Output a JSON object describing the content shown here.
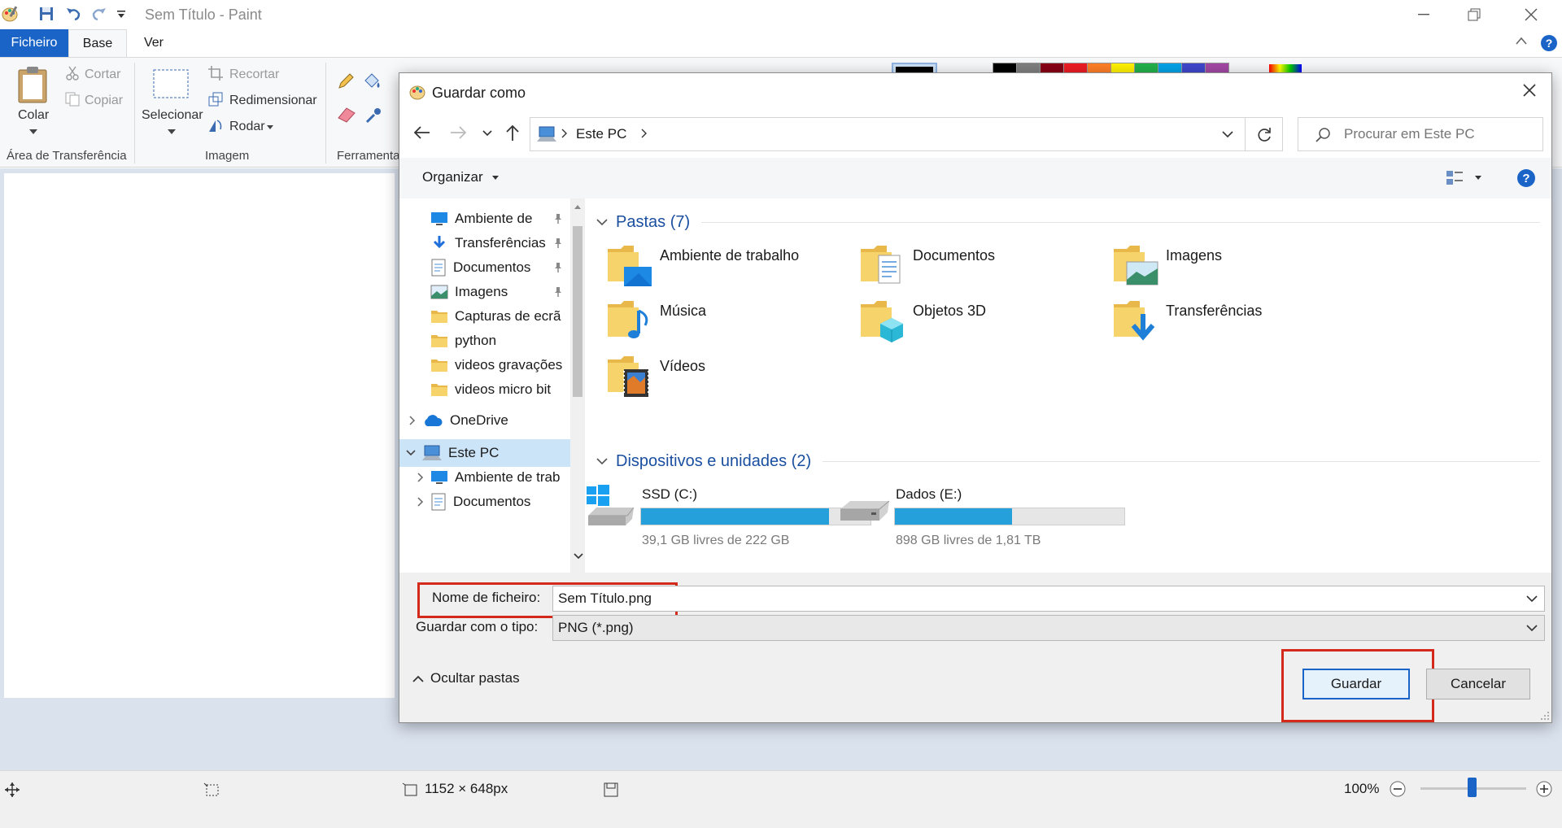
{
  "paint": {
    "window_title": "Sem Título - Paint",
    "tabs": {
      "file": "Ficheiro",
      "home": "Base",
      "view": "Ver"
    },
    "clipboard": {
      "paste": "Colar",
      "cut": "Cortar",
      "copy": "Copiar",
      "group": "Área de Transferência"
    },
    "image": {
      "select": "Selecionar",
      "crop": "Recortar",
      "resize": "Redimensionar",
      "rotate": "Rodar",
      "group": "Imagem"
    },
    "tools": {
      "group": "Ferramenta"
    },
    "colors": [
      "#000000",
      "#7f7f7f",
      "#880015",
      "#ed1c24",
      "#ff7f27",
      "#fff200",
      "#22b14c",
      "#00a2e8",
      "#3f48cc",
      "#a349a4"
    ],
    "status": {
      "dimensions": "1152 × 648px",
      "zoom": "100%"
    }
  },
  "dialog": {
    "title": "Guardar como",
    "address": {
      "location": "Este PC"
    },
    "search_placeholder": "Procurar em Este PC",
    "toolbar": {
      "organize": "Organizar"
    },
    "nav": [
      {
        "label": "Ambiente de",
        "icon": "desktop-icon",
        "pinned": true
      },
      {
        "label": "Transferências",
        "icon": "download-icon",
        "pinned": true
      },
      {
        "label": "Documentos",
        "icon": "documents-icon",
        "pinned": true
      },
      {
        "label": "Imagens",
        "icon": "pictures-icon",
        "pinned": true
      },
      {
        "label": "Capturas de ecrã",
        "icon": "folder-icon"
      },
      {
        "label": "python",
        "icon": "folder-icon"
      },
      {
        "label": "videos gravações",
        "icon": "folder-icon"
      },
      {
        "label": "videos micro bit",
        "icon": "folder-icon"
      },
      {
        "label": "OneDrive",
        "icon": "onedrive-icon"
      },
      {
        "label": "Este PC",
        "icon": "this-pc-icon"
      },
      {
        "label": "Ambiente de trab",
        "icon": "desktop-icon"
      },
      {
        "label": "Documentos",
        "icon": "documents-icon"
      }
    ],
    "folders_header": "Pastas (7)",
    "folders": [
      {
        "name": "Ambiente de trabalho",
        "icon": "desktop-folder-icon"
      },
      {
        "name": "Documentos",
        "icon": "documents-folder-icon"
      },
      {
        "name": "Imagens",
        "icon": "pictures-folder-icon"
      },
      {
        "name": "Música",
        "icon": "music-folder-icon"
      },
      {
        "name": "Objetos 3D",
        "icon": "3d-objects-folder-icon"
      },
      {
        "name": "Transferências",
        "icon": "downloads-folder-icon"
      },
      {
        "name": "Vídeos",
        "icon": "videos-folder-icon"
      }
    ],
    "devices_header": "Dispositivos e unidades (2)",
    "drives": [
      {
        "name": "SSD (C:)",
        "free": "39,1 GB livres de 222 GB",
        "used_fraction": 0.82,
        "icon": "system-drive-icon"
      },
      {
        "name": "Dados (E:)",
        "free": "898 GB livres de 1,81 TB",
        "used_fraction": 0.51,
        "icon": "drive-icon"
      }
    ],
    "filename": {
      "label": "Nome de ficheiro:",
      "value": "Sem Título.png"
    },
    "filetype": {
      "label": "Guardar com o tipo:",
      "value": "PNG (*.png)"
    },
    "hide_folders": "Ocultar pastas",
    "save": "Guardar",
    "cancel": "Cancelar",
    "accent": "#1a4fa0",
    "highlight": "#d42a1b"
  }
}
